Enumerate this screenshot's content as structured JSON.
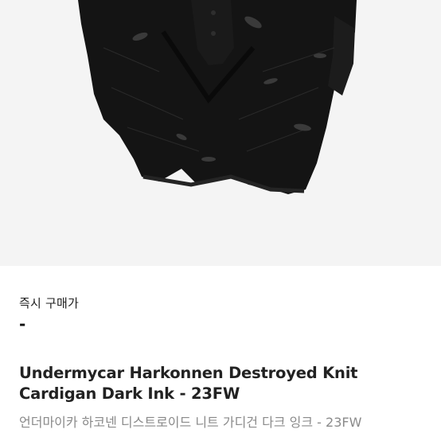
{
  "product": {
    "image_alt": "Undermycar Harkonnen Destroyed Knit Cardigan Dark Ink",
    "price_label": "즉시 구매가",
    "price_value": "-",
    "title_en": "Undermycar Harkonnen Destroyed Knit Cardigan Dark Ink - 23FW",
    "title_ko": "언더마이카 하코넨 디스트로이드 니트 가디건 다크 잉크 - 23FW"
  },
  "colors": {
    "image_background": "#f4f4f4",
    "garment": "#141414",
    "title": "#222222",
    "subtitle": "#8a8a8a"
  }
}
